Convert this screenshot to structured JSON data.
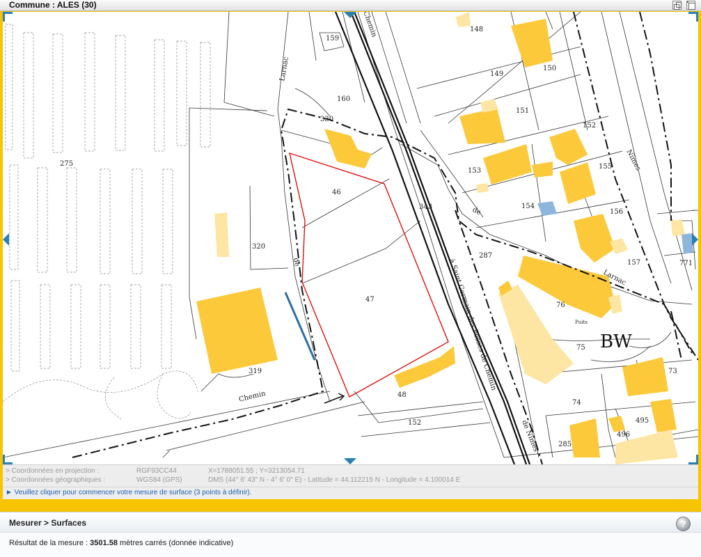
{
  "window": {
    "title": "Commune : ALES (30)",
    "restore_icon": "restore-window-icon",
    "maximize_icon": "maximize-window-icon"
  },
  "map": {
    "section_label": "BW",
    "parcels": [
      "148",
      "149",
      "150",
      "151",
      "152",
      "153",
      "154",
      "155",
      "156",
      "157",
      "159",
      "160",
      "275",
      "285",
      "287",
      "319",
      "320",
      "330",
      "343",
      "46",
      "47",
      "48",
      "495",
      "496",
      "73",
      "74",
      "75",
      "76",
      "771",
      "152"
    ],
    "streets": [
      "Larnac",
      "de",
      "Chemin",
      "à Saint Germain des Fossés de Chemin",
      "de Nîmes",
      "de",
      "Larnac",
      "Nîmes",
      "Chemin",
      "de",
      "Puits"
    ],
    "colors": {
      "building": "#fcc93a",
      "building_light": "#fde6a3",
      "water": "#8eb6dc",
      "selection": "#e01010",
      "measure_line": "#2a6ea8",
      "nav_accent": "#2a7fb6"
    },
    "nav_icons": [
      "pan-up-icon",
      "pan-down-icon",
      "pan-left-icon",
      "pan-right-icon"
    ]
  },
  "coords": {
    "proj_label": "> Coordonnées en projection :",
    "proj_system": "RGF93CC44",
    "proj_value": "X=1788051.55 ; Y=3213054.71",
    "geo_label": "> Coordonnées géographiques :",
    "geo_system": "WGS84 (GPS)",
    "geo_value": "DMS (44° 6' 43\" N - 4° 6' 0\" E) - Latitude = 44.112215 N - Longitude = 4.100014 E",
    "instruction": "► Veuillez cliquer pour commencer votre mesure de surface (3 points à définir)."
  },
  "measure": {
    "title": "Mesurer > Surfaces",
    "help_label": "?",
    "result_prefix": "Résultat de la mesure : ",
    "result_value": "3501.58",
    "result_suffix": " mètres carrés (donnée indicative)"
  }
}
